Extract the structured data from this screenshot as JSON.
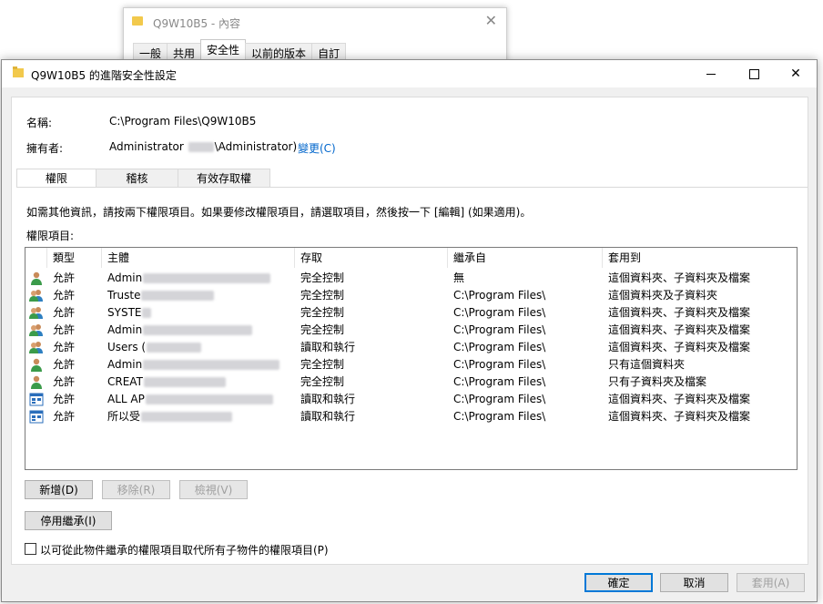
{
  "background_window": {
    "title": "Q9W10B5 - 內容",
    "tabs": [
      "一般",
      "共用",
      "安全性",
      "以前的版本",
      "自訂"
    ],
    "active_tab": "安全性"
  },
  "dialog": {
    "title": "Q9W10B5 的進階安全性設定",
    "name_label": "名稱:",
    "name_value": "C:\\Program Files\\Q9W10B5",
    "owner_label": "擁有者:",
    "owner_value_prefix": "Administrator",
    "owner_value_suffix": "\\Administrator)",
    "change_link": "變更(C)",
    "tabs": [
      "權限",
      "稽核",
      "有效存取權"
    ],
    "active_tab": "權限",
    "instructions": "如需其他資訊，請按兩下權限項目。如果要修改權限項目，請選取項目，然後按一下 [編輯] (如果適用)。",
    "entries_label": "權限項目:",
    "columns": [
      "類型",
      "主體",
      "存取",
      "繼承自",
      "套用到"
    ],
    "rows": [
      {
        "icon": "user-icon",
        "type": "允許",
        "principal": "Admin",
        "access": "完全控制",
        "inherited": "無",
        "applies": "這個資料夾、子資料夾及檔案"
      },
      {
        "icon": "group-icon",
        "type": "允許",
        "principal": "Truste",
        "access": "完全控制",
        "inherited": "C:\\Program Files\\",
        "applies": "這個資料夾及子資料夾"
      },
      {
        "icon": "group-icon",
        "type": "允許",
        "principal": "SYSTE",
        "access": "完全控制",
        "inherited": "C:\\Program Files\\",
        "applies": "這個資料夾、子資料夾及檔案"
      },
      {
        "icon": "group-icon",
        "type": "允許",
        "principal": "Admin",
        "access": "完全控制",
        "inherited": "C:\\Program Files\\",
        "applies": "這個資料夾、子資料夾及檔案"
      },
      {
        "icon": "group-icon",
        "type": "允許",
        "principal": "Users (",
        "access": "讀取和執行",
        "inherited": "C:\\Program Files\\",
        "applies": "這個資料夾、子資料夾及檔案"
      },
      {
        "icon": "user-icon",
        "type": "允許",
        "principal": "Admin",
        "access": "完全控制",
        "inherited": "C:\\Program Files\\",
        "applies": "只有這個資料夾"
      },
      {
        "icon": "user-icon",
        "type": "允許",
        "principal": "CREAT",
        "access": "完全控制",
        "inherited": "C:\\Program Files\\",
        "applies": "只有子資料夾及檔案"
      },
      {
        "icon": "app-package-icon",
        "type": "允許",
        "principal": "ALL AP",
        "access": "讀取和執行",
        "inherited": "C:\\Program Files\\",
        "applies": "這個資料夾、子資料夾及檔案"
      },
      {
        "icon": "app-package-icon",
        "type": "允許",
        "principal": "所以受",
        "access": "讀取和執行",
        "inherited": "C:\\Program Files\\",
        "applies": "這個資料夾、子資料夾及檔案"
      }
    ],
    "buttons": {
      "add": "新增(D)",
      "remove": "移除(R)",
      "view": "檢視(V)",
      "disable_inheritance": "停用繼承(I)",
      "replace_checkbox": "以可從此物件繼承的權限項目取代所有子物件的權限項目(P)",
      "ok": "確定",
      "cancel": "取消",
      "apply": "套用(A)"
    }
  }
}
